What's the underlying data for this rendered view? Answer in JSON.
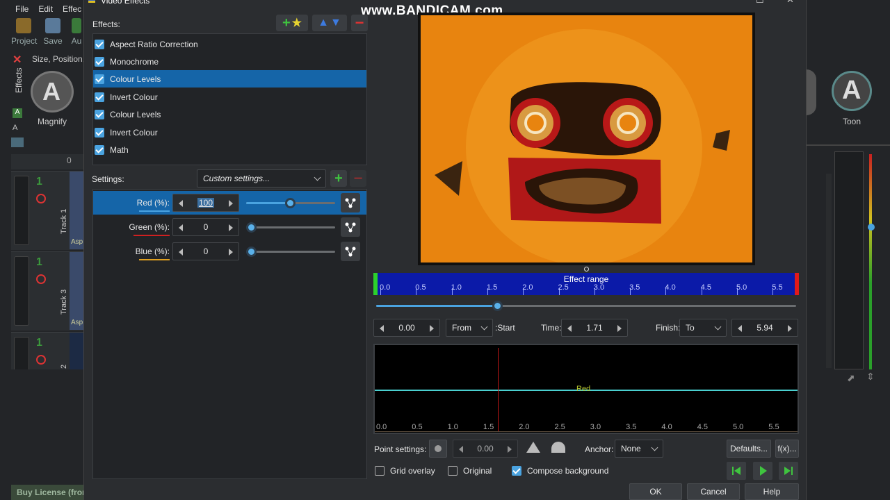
{
  "watermark": "www.BANDICAM.com",
  "background_app": {
    "menu": [
      "File",
      "Edit",
      "Effec"
    ],
    "toolbar": [
      {
        "label": "Project"
      },
      {
        "label": "Save"
      },
      {
        "label": "Au"
      }
    ],
    "breadcrumb": "Size, Position,",
    "side_tab": "Effects",
    "thumbnails": [
      {
        "label": "Magnify"
      },
      {
        "label": "Toon"
      }
    ],
    "ruler_zero": "0",
    "tracks": [
      {
        "number": "1",
        "name": "Track 1",
        "clip_label": "Asp"
      },
      {
        "number": "1",
        "name": "Track 3",
        "clip_label": "Asp"
      },
      {
        "number": "1",
        "name": "2",
        "clip_label": ""
      }
    ],
    "buy_license": "Buy License (from"
  },
  "dialog": {
    "title": "Video Effects",
    "effects_label": "Effects:",
    "effects": [
      {
        "label": "Aspect Ratio Correction",
        "checked": true,
        "selected": false
      },
      {
        "label": "Monochrome",
        "checked": true,
        "selected": false
      },
      {
        "label": "Colour Levels",
        "checked": true,
        "selected": true
      },
      {
        "label": "Invert Colour",
        "checked": true,
        "selected": false
      },
      {
        "label": "Colour Levels",
        "checked": true,
        "selected": false
      },
      {
        "label": "Invert Colour",
        "checked": true,
        "selected": false
      },
      {
        "label": "Math",
        "checked": true,
        "selected": false
      }
    ],
    "settings_label": "Settings:",
    "settings_preset": "Custom settings...",
    "channels": [
      {
        "name": "Red (%):",
        "value": "100",
        "level": 0.5,
        "underline": "#4aa3e0",
        "selected": true
      },
      {
        "name": "Green (%):",
        "value": "0",
        "level": 0,
        "underline": "#d02020",
        "selected": false
      },
      {
        "name": "Blue (%):",
        "value": "0",
        "level": 0,
        "underline": "#e0a020",
        "selected": false
      }
    ],
    "effect_range": {
      "title": "Effect range",
      "ticks": [
        "0.0",
        "0.5",
        "1.0",
        "1.5",
        "2.0",
        "2.5",
        "3.0",
        "3.5",
        "4.0",
        "4.5",
        "5.0",
        "5.5"
      ],
      "slider_level": 0.29
    },
    "range_controls": {
      "start_value": "0.00",
      "from_option": "From",
      "start_label": ":Start",
      "time_label": "Time:",
      "time_value": "1.71",
      "finish_label": "Finish:",
      "to_option": "To",
      "finish_value": "5.94"
    },
    "graph": {
      "series_label": "Red",
      "ticks": [
        "0.0",
        "0.5",
        "1.0",
        "1.5",
        "2.0",
        "2.5",
        "3.0",
        "3.5",
        "4.0",
        "4.5",
        "5.0",
        "5.5"
      ]
    },
    "point_settings": {
      "label": "Point settings:",
      "value": "0.00",
      "anchor_label": "Anchor:",
      "anchor_value": "None",
      "defaults_label": "Defaults...",
      "fx_label": "f(x)..."
    },
    "options": [
      {
        "label": "Grid overlay",
        "checked": false
      },
      {
        "label": "Original",
        "checked": false
      },
      {
        "label": "Compose background",
        "checked": true
      }
    ],
    "buttons": {
      "ok": "OK",
      "cancel": "Cancel",
      "help": "Help"
    },
    "colors": {
      "accent": "#4aa3e0",
      "selection": "#1565a8",
      "preview": "#e8840f",
      "range_bar": "#0b1aa8",
      "graph_line": "#4ad0d0"
    }
  }
}
